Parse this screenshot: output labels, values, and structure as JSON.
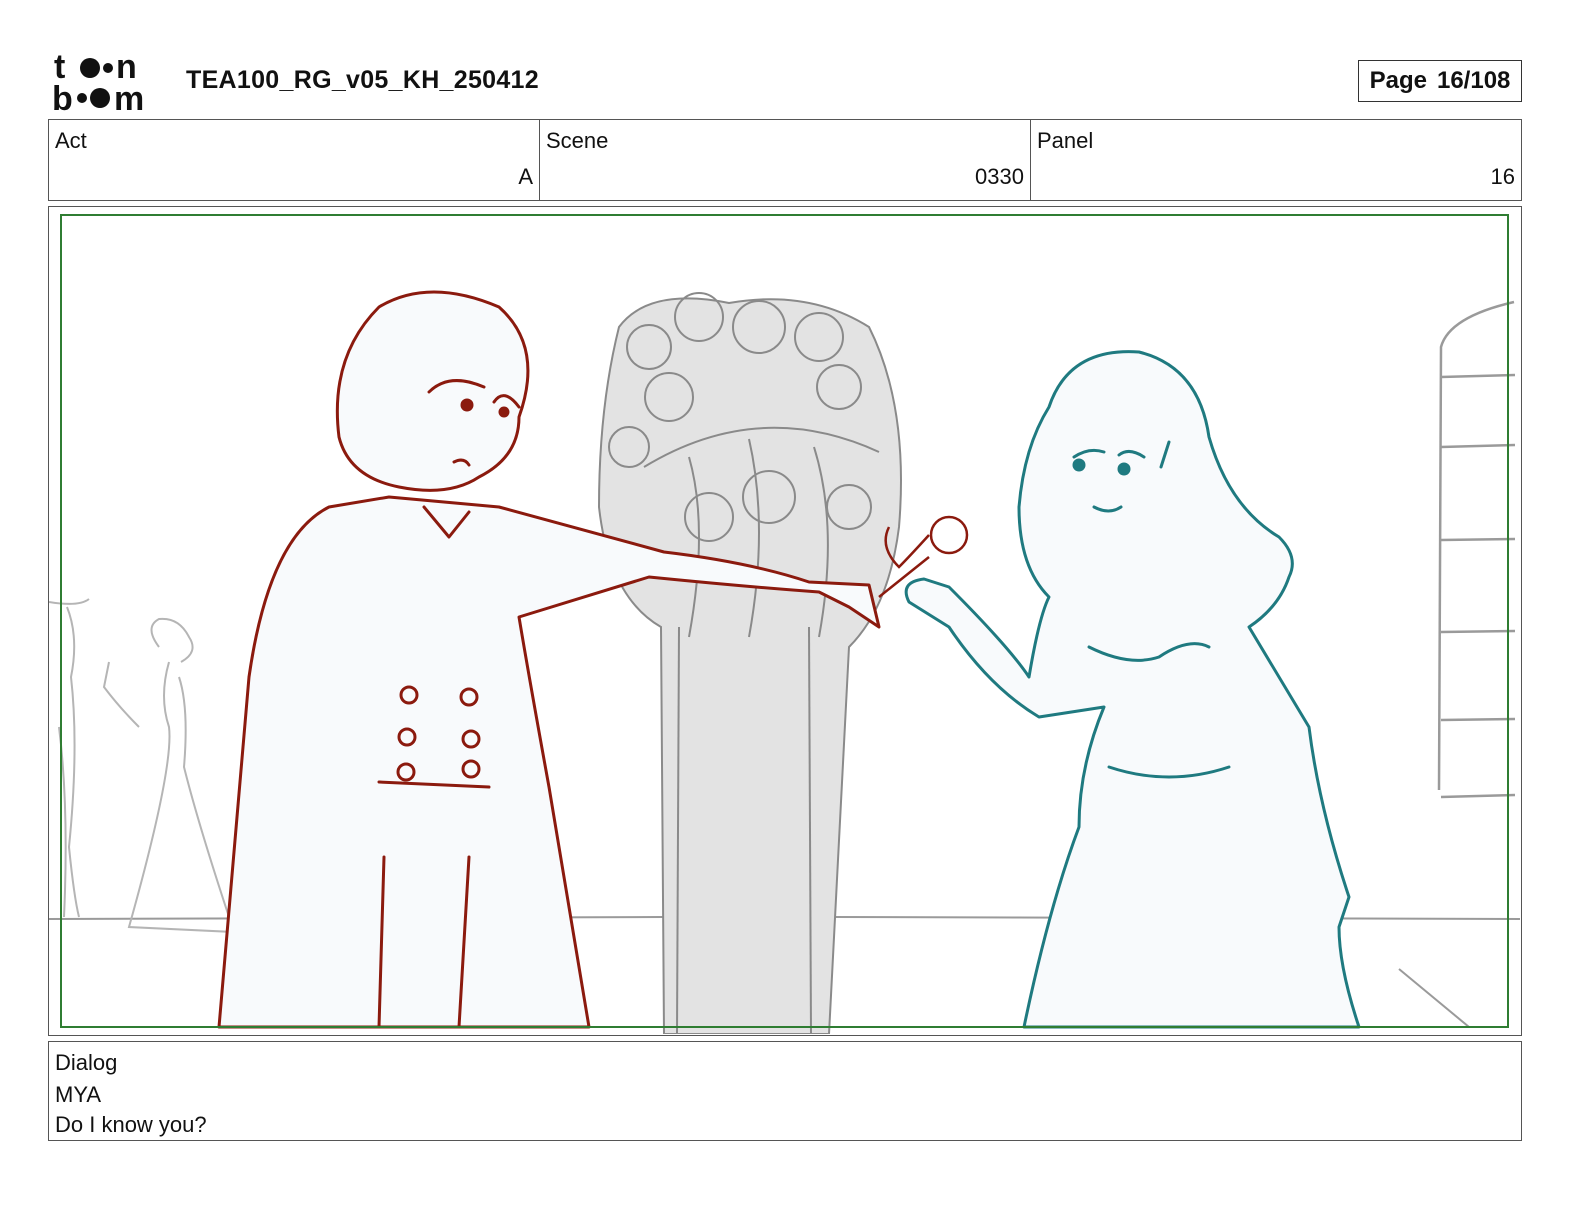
{
  "header": {
    "logo_text": "toonboom",
    "document_title": "TEA100_RG_v05_KH_250412",
    "page_label": "Page",
    "page_number": "16/108"
  },
  "info": {
    "act_label": "Act",
    "act_value": "A",
    "scene_label": "Scene",
    "scene_value": "0330",
    "panel_label": "Panel",
    "panel_value": "16"
  },
  "panel_image": {
    "description_icon": "storyboard-drawing",
    "colors": {
      "left_character": "#8b1a0e",
      "right_character": "#1f7a80",
      "background_lines": "#9a9a9a",
      "safe_frame": "#2f7d32"
    }
  },
  "dialog": {
    "label": "Dialog",
    "speaker": "MYA",
    "line": "Do I know you?"
  }
}
